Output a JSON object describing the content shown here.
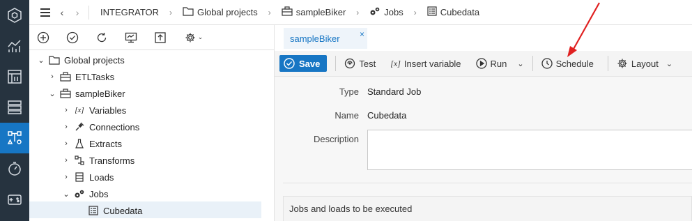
{
  "topbar": {
    "breadcrumb": [
      "INTEGRATOR",
      "Global projects",
      "sampleBiker",
      "Jobs",
      "Cubedata"
    ]
  },
  "tree": {
    "items": [
      {
        "label": "Global projects",
        "depth": 0,
        "expanded": true
      },
      {
        "label": "ETLTasks",
        "depth": 1,
        "expanded": false
      },
      {
        "label": "sampleBiker",
        "depth": 1,
        "expanded": true
      },
      {
        "label": "Variables",
        "depth": 2,
        "expanded": false
      },
      {
        "label": "Connections",
        "depth": 2,
        "expanded": false
      },
      {
        "label": "Extracts",
        "depth": 2,
        "expanded": false
      },
      {
        "label": "Transforms",
        "depth": 2,
        "expanded": false
      },
      {
        "label": "Loads",
        "depth": 2,
        "expanded": false
      },
      {
        "label": "Jobs",
        "depth": 2,
        "expanded": true
      },
      {
        "label": "Cubedata",
        "depth": 3,
        "selected": true
      }
    ]
  },
  "tab": {
    "label": "sampleBiker",
    "close": "×"
  },
  "actions": {
    "save": "Save",
    "test": "Test",
    "insert_variable": "Insert variable",
    "run": "Run",
    "schedule": "Schedule",
    "layout": "Layout"
  },
  "form": {
    "type_label": "Type",
    "type_value": "Standard Job",
    "name_label": "Name",
    "name_value": "Cubedata",
    "description_label": "Description",
    "description_value": ""
  },
  "section": {
    "title": "Jobs and loads to be executed"
  },
  "colors": {
    "accent": "#1776c4",
    "rail": "#26333f",
    "annotation": "#e02020"
  }
}
